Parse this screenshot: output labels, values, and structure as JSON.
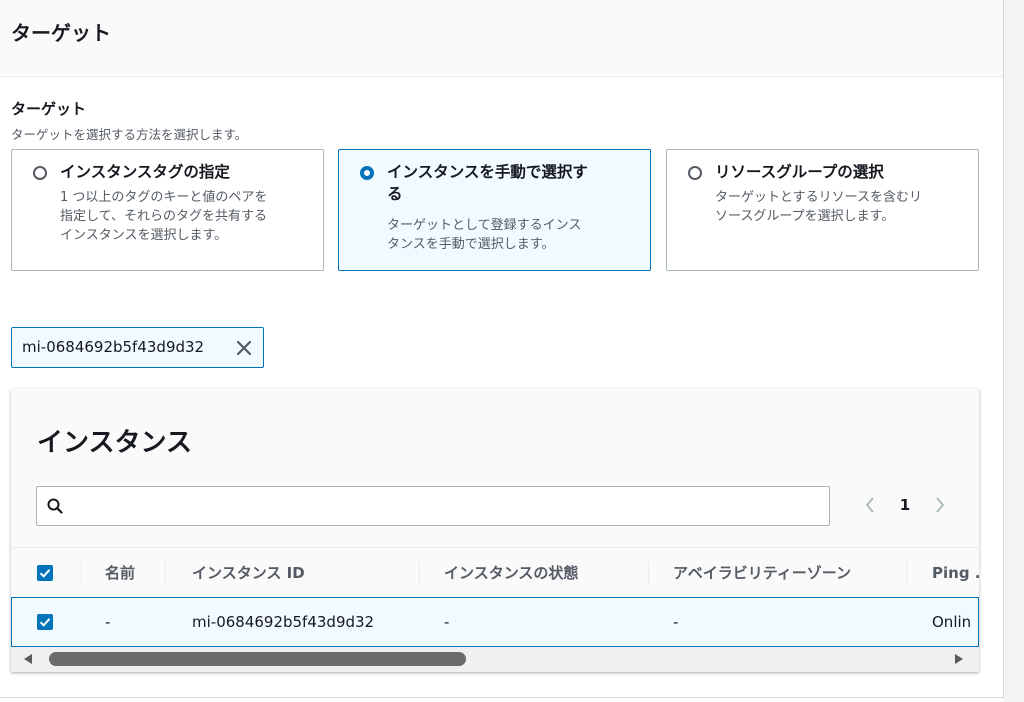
{
  "section": {
    "title": "ターゲット"
  },
  "targets_field": {
    "label": "ターゲット",
    "description": "ターゲットを選択する方法を選択します。"
  },
  "tiles": [
    {
      "title": "インスタンスタグの指定",
      "desc_lines": [
        "1 つ以上のタグのキーと値のペアを",
        "指定して、それらのタグを共有する",
        "インスタンスを選択します。"
      ],
      "selected": false
    },
    {
      "title_lines": [
        "インスタンスを手動で選択す",
        "る"
      ],
      "desc_lines": [
        "ターゲットとして登録するインス",
        "タンスを手動で選択します。"
      ],
      "selected": true
    },
    {
      "title": "リソースグループの選択",
      "desc_lines": [
        "ターゲットとするリソースを含むリ",
        "ソースグループを選択します。"
      ],
      "selected": false
    }
  ],
  "selected_token": {
    "label": "mi-0684692b5f43d9d32"
  },
  "instances_table": {
    "title": "インスタンス",
    "search": {
      "value": "",
      "placeholder": ""
    },
    "pagination": {
      "current_page": "1"
    },
    "columns": [
      "名前",
      "インスタンス ID",
      "インスタンスの状態",
      "アベイラビリティーゾーン",
      "Ping ..."
    ],
    "rows": [
      {
        "selected": true,
        "name": "-",
        "instance_id": "mi-0684692b5f43d9d32",
        "state": "-",
        "az": "-",
        "ping": "Onlin"
      }
    ]
  },
  "colors": {
    "accent": "#0073bb",
    "selected_bg": "#f1faff",
    "border": "#aab7b8"
  }
}
